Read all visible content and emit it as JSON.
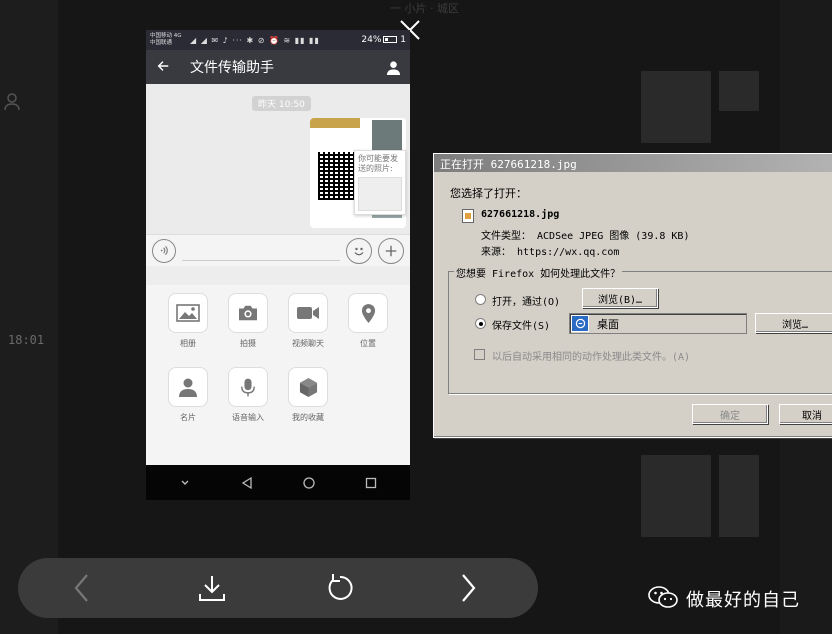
{
  "background": {
    "top_text": "一 小片 · 城区",
    "side_time": "18:01"
  },
  "phone": {
    "status": {
      "carrier_line1": "中国移动 4G",
      "carrier_line2": "中国联通",
      "icons": "◢ ◢ ✉ ♪ ··· ✱ ⊘ ⏰ ≋ ▮▮ ▮▮",
      "battery": "24%",
      "time": "1"
    },
    "title": "文件传输助手",
    "timestamp": "昨天 10:50",
    "tooltip": "你可能要发送的照片:",
    "panel_items": [
      {
        "label": "相册",
        "icon": "album-icon"
      },
      {
        "label": "拍摄",
        "icon": "camera-icon"
      },
      {
        "label": "视频聊天",
        "icon": "video-icon"
      },
      {
        "label": "位置",
        "icon": "location-icon"
      },
      {
        "label": "名片",
        "icon": "contact-card-icon"
      },
      {
        "label": "语音输入",
        "icon": "microphone-icon"
      },
      {
        "label": "我的收藏",
        "icon": "favorites-icon"
      }
    ]
  },
  "dialog": {
    "title": "正在打开 627661218.jpg",
    "chose_label": "您选择了打开：",
    "filename": "627661218.jpg",
    "file_type": "文件类型： ACDSee JPEG 图像 (39.8 KB)",
    "source": "来源： https://wx.qq.com",
    "question": "您想要 Firefox 如何处理此文件？",
    "open_with_label": "打开，通过(O)",
    "browse_open_label": "浏览(B)…",
    "save_file_label": "保存文件(S)",
    "save_location": "桌面",
    "browse_save_label": "浏览…",
    "auto_label": "以后自动采用相同的动作处理此类文件。(A)",
    "ok_label": "确定",
    "cancel_label": "取消"
  },
  "watermark": {
    "text": "做最好的自己"
  },
  "colors": {
    "wechat_title_bar": "#393a3f",
    "viewer_bar": "#3b3b3b",
    "dialog_face": "#d4d0c8"
  }
}
